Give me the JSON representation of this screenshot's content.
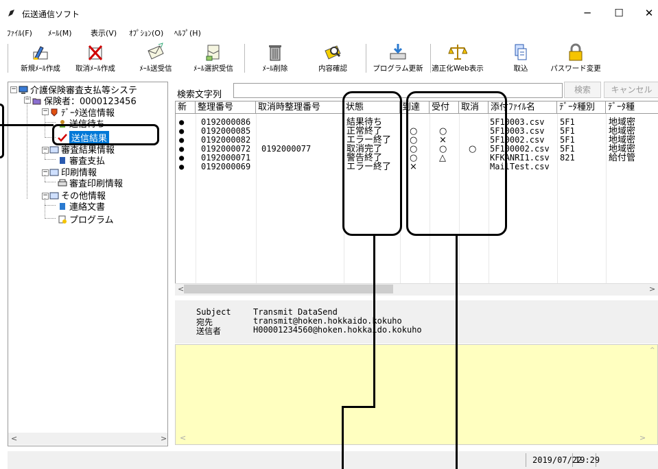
{
  "window": {
    "title": "伝送通信ソフト",
    "minimize": "─",
    "maximize": "☐",
    "close": "✕"
  },
  "menu": [
    "ﾌｧｲﾙ(F)",
    "ﾒｰﾙ(M)",
    "表示(V)",
    "ｵﾌﾟｼｮﾝ(O)",
    "ﾍﾙﾌﾟ(H)"
  ],
  "toolbar": [
    {
      "label": "新規ﾒｰﾙ作成",
      "icon": "new-mail-icon"
    },
    {
      "label": "取消ﾒｰﾙ作成",
      "icon": "cancel-mail-icon"
    },
    {
      "label": "ﾒｰﾙ送受信",
      "icon": "send-receive-icon"
    },
    {
      "label": "ﾒｰﾙ選択受信",
      "icon": "select-receive-icon"
    },
    {
      "label": "ﾒｰﾙ削除",
      "icon": "trash-icon"
    },
    {
      "label": "内容確認",
      "icon": "confirm-icon"
    },
    {
      "label": "プログラム更新",
      "icon": "update-icon"
    },
    {
      "label": "適正化Web表示",
      "icon": "scale-icon"
    },
    {
      "label": "取込",
      "icon": "import-icon"
    },
    {
      "label": "パスワード変更",
      "icon": "lock-icon"
    }
  ],
  "tree": {
    "root": "介護保険審査支払等システ",
    "insurer": "保険者：0000123456",
    "send_info": "ﾃﾞｰﾀ送信情報",
    "send_wait": "送信待ち",
    "send_result": "送信結果",
    "review_info": "審査結果情報",
    "review_pay": "審査支払",
    "print_info": "印刷情報",
    "review_print": "審査印刷情報",
    "other_info": "その他情報",
    "contact_doc": "連絡文書",
    "program": "プログラム"
  },
  "search": {
    "label": "検索文字列",
    "value": "",
    "search_button": "検索",
    "cancel_button": "キャンセル"
  },
  "table": {
    "columns": [
      "新",
      "整理番号",
      "取消時整理番号",
      "状態",
      "到達",
      "受付",
      "取消",
      "添付ﾌｧｲﾙ名",
      "ﾃﾞｰﾀ種別",
      "ﾃﾞｰﾀ種"
    ],
    "rows": [
      {
        "new": "●",
        "id": "0192000086",
        "cancel_id": "",
        "status": "結果待ち",
        "arrive": "",
        "accept": "",
        "cancel": "",
        "file": "5F10003.csv",
        "kind": "5F1",
        "kind2": "地域密"
      },
      {
        "new": "●",
        "id": "0192000085",
        "cancel_id": "",
        "status": "正常終了",
        "arrive": "○",
        "accept": "○",
        "cancel": "",
        "file": "5F10003.csv",
        "kind": "5F1",
        "kind2": "地域密"
      },
      {
        "new": "●",
        "id": "0192000082",
        "cancel_id": "",
        "status": "エラー終了",
        "arrive": "○",
        "accept": "×",
        "cancel": "",
        "file": "5F10002.csv",
        "kind": "5F1",
        "kind2": "地域密"
      },
      {
        "new": "●",
        "id": "0192000072",
        "cancel_id": "0192000077",
        "status": "取消完了",
        "arrive": "○",
        "accept": "○",
        "cancel": "○",
        "file": "5F100002.csv",
        "kind": "5F1",
        "kind2": "地域密"
      },
      {
        "new": "●",
        "id": "0192000071",
        "cancel_id": "",
        "status": "警告終了",
        "arrive": "○",
        "accept": "△",
        "cancel": "",
        "file": "KFKANRI1.csv",
        "kind": "821",
        "kind2": "給付管"
      },
      {
        "new": "●",
        "id": "0192000069",
        "cancel_id": "",
        "status": "エラー終了",
        "arrive": "×",
        "accept": "",
        "cancel": "",
        "file": "MailTest.csv",
        "kind": "",
        "kind2": ""
      }
    ]
  },
  "message": {
    "subject_label": "Subject",
    "subject": "Transmit DataSend",
    "to_label": "宛先",
    "to": "transmit@hoken.hokkaido.kokuho",
    "from_label": "送信者",
    "from": "H00001234560@hoken.hokkaido.kokuho"
  },
  "status": {
    "date": "2019/07/22",
    "time": "19:29"
  },
  "colors": {
    "selection": "#0078d7",
    "body_bg": "#ffffc0",
    "check": "#d00000"
  }
}
